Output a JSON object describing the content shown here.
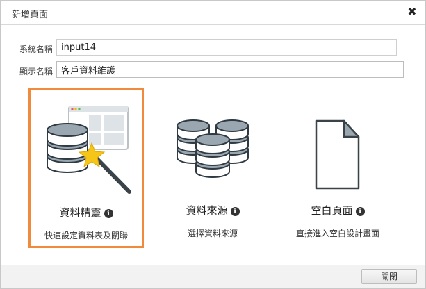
{
  "dialog": {
    "title": "新增頁面",
    "close_icon": "close-icon"
  },
  "form": {
    "system_name_label": "系統名稱",
    "system_name_value": "input14",
    "display_name_label": "顯示名稱",
    "display_name_value": "客戶資料維護"
  },
  "options": [
    {
      "title": "資料精靈",
      "desc": "快速設定資料表及關聯",
      "icon": "database-wizard-icon",
      "selected": true
    },
    {
      "title": "資料來源",
      "desc": "選擇資料來源",
      "icon": "database-stack-icon",
      "selected": false
    },
    {
      "title": "空白頁面",
      "desc": "直接進入空白設計畫面",
      "icon": "blank-page-icon",
      "selected": false
    }
  ],
  "footer": {
    "close_label": "關閉"
  },
  "colors": {
    "selected_border": "#f08a3c",
    "db_fill": "#9aa7b1",
    "db_stroke": "#2f3a42",
    "star": "#f5c518"
  }
}
